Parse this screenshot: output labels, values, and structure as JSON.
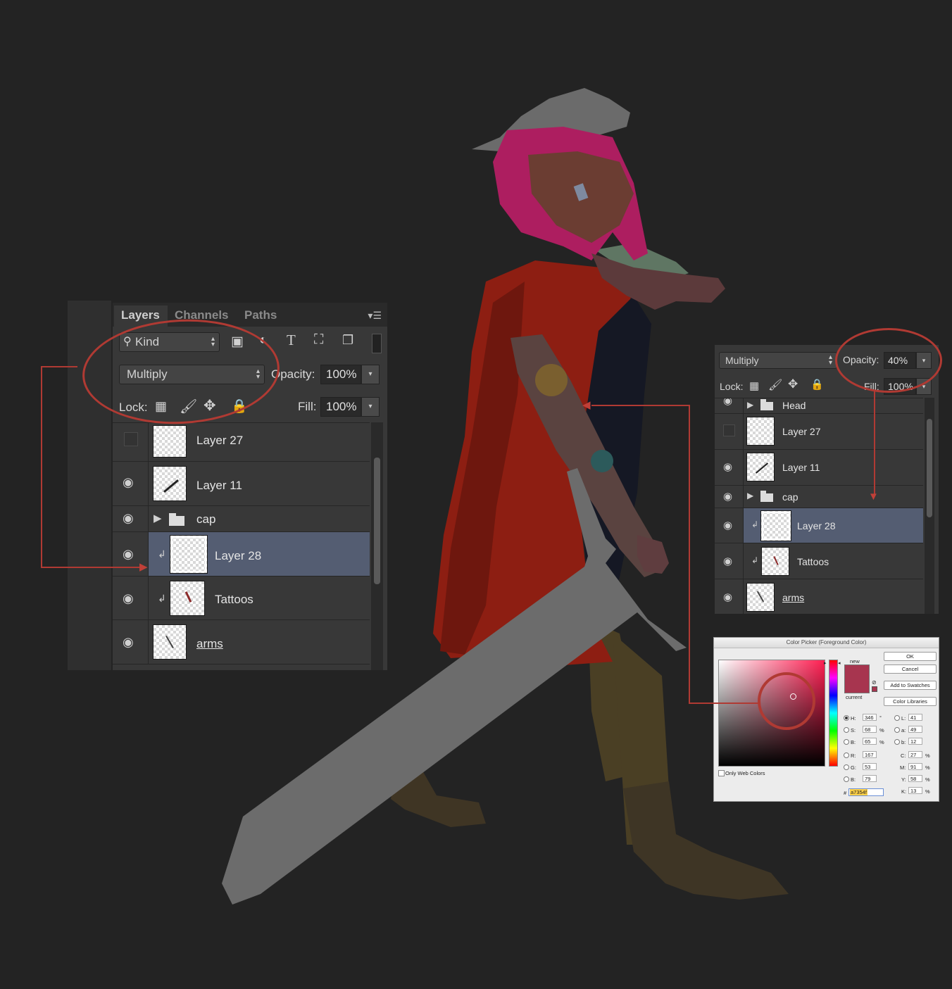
{
  "layers_panel": {
    "tabs": [
      "Layers",
      "Channels",
      "Paths"
    ],
    "filter_label": "Kind",
    "blend_mode": "Multiply",
    "opacity_label": "Opacity:",
    "opacity_value": "100%",
    "lock_label": "Lock:",
    "fill_label": "Fill:",
    "fill_value": "100%",
    "layers": [
      {
        "name": "Layer 27",
        "visible": false,
        "type": "layer"
      },
      {
        "name": "Layer 11",
        "visible": true,
        "type": "layer"
      },
      {
        "name": "cap",
        "visible": true,
        "type": "group"
      },
      {
        "name": "Layer 28",
        "visible": true,
        "type": "layer",
        "clipped": true,
        "selected": true
      },
      {
        "name": "Tattoos",
        "visible": true,
        "type": "layer",
        "clipped": true
      },
      {
        "name": "arms",
        "visible": true,
        "type": "layer"
      }
    ]
  },
  "layers_panel_small": {
    "blend_mode": "Multiply",
    "opacity_label": "Opacity:",
    "opacity_value": "40%",
    "lock_label": "Lock:",
    "fill_label": "Fill:",
    "fill_value": "100%",
    "layers": [
      {
        "name": "Head",
        "visible": true,
        "type": "group"
      },
      {
        "name": "Layer 27",
        "visible": false,
        "type": "layer"
      },
      {
        "name": "Layer 11",
        "visible": true,
        "type": "layer"
      },
      {
        "name": "cap",
        "visible": true,
        "type": "group"
      },
      {
        "name": "Layer 28",
        "visible": true,
        "type": "layer",
        "clipped": true,
        "selected": true
      },
      {
        "name": "Tattoos",
        "visible": true,
        "type": "layer",
        "clipped": true
      },
      {
        "name": "arms",
        "visible": true,
        "type": "layer"
      }
    ]
  },
  "color_picker": {
    "title": "Color Picker (Foreground Color)",
    "buttons": {
      "ok": "OK",
      "cancel": "Cancel",
      "add_swatches": "Add to Swatches",
      "libraries": "Color Libraries"
    },
    "new_label": "new",
    "current_label": "current",
    "only_web_colors": "Only Web Colors",
    "fields": {
      "H": "346",
      "S": "68",
      "B": "65",
      "R": "167",
      "G": "53",
      "B2": "79",
      "L": "41",
      "a": "49",
      "b": "12",
      "C": "27",
      "M": "91",
      "Y": "58",
      "K": "13"
    },
    "units": {
      "deg": "°",
      "pct": "%"
    },
    "hex_label": "#",
    "hex": "a7354f",
    "new_color": "#a7354f",
    "current_color": "#a7354f"
  },
  "colors": {
    "annotation": "#b03a33",
    "selected_row": "#545d72",
    "panel_bg": "#383838"
  }
}
